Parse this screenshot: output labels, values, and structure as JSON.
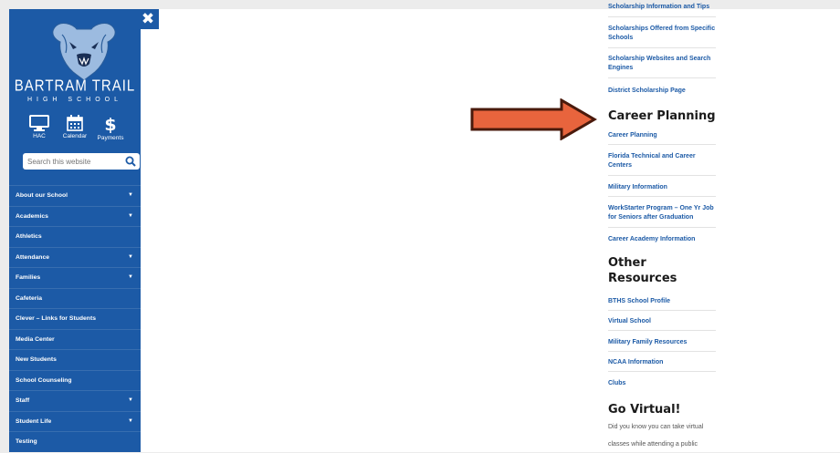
{
  "colors": {
    "sidebar": "#1c5aa6",
    "link": "#1c5aa6",
    "arrow_fill": "#e8643d",
    "arrow_outline": "#4a1a0c",
    "heading": "#1a1a1a"
  },
  "sidebar": {
    "close_icon": "close-icon",
    "school_name": "BARTRAM TRAIL",
    "school_sub": "HIGH SCHOOL",
    "quick_links": [
      {
        "label": "HAC",
        "icon": "monitor-icon"
      },
      {
        "label": "Calendar",
        "icon": "calendar-icon"
      },
      {
        "label": "Payments",
        "icon": "dollar-icon"
      }
    ],
    "search_placeholder": "Search this website",
    "nav": [
      {
        "label": "About our School",
        "has_submenu": true
      },
      {
        "label": "Academics",
        "has_submenu": true
      },
      {
        "label": "Athletics",
        "has_submenu": false
      },
      {
        "label": "Attendance",
        "has_submenu": true
      },
      {
        "label": "Families",
        "has_submenu": true
      },
      {
        "label": "Cafeteria",
        "has_submenu": false
      },
      {
        "label": "Clever – Links for Students",
        "has_submenu": false
      },
      {
        "label": "Media Center",
        "has_submenu": false
      },
      {
        "label": "New Students",
        "has_submenu": false
      },
      {
        "label": "School Counseling",
        "has_submenu": false
      },
      {
        "label": "Staff",
        "has_submenu": true
      },
      {
        "label": "Student Life",
        "has_submenu": true
      },
      {
        "label": "Testing",
        "has_submenu": false
      }
    ]
  },
  "main": {
    "scholarship_links": [
      "Scholarship Information and Tips",
      "Scholarships Offered from Specific Schools",
      "Scholarship Websites and Search Engines",
      "District Scholarship Page"
    ],
    "career_heading": "Career Planning",
    "career_links": [
      "Career Planning",
      "Florida Technical and Career Centers",
      "Military Information",
      "WorkStarter Program – One Yr Job for Seniors after Graduation",
      "Career Academy Information"
    ],
    "other_heading": "Other Resources",
    "other_links": [
      "BTHS School Profile",
      "Virtual School",
      "Military Family Resources",
      "NCAA Information",
      "Clubs"
    ],
    "virtual_heading": "Go Virtual!",
    "virtual_text": "Did you know you can take virtual classes while attending a public"
  }
}
